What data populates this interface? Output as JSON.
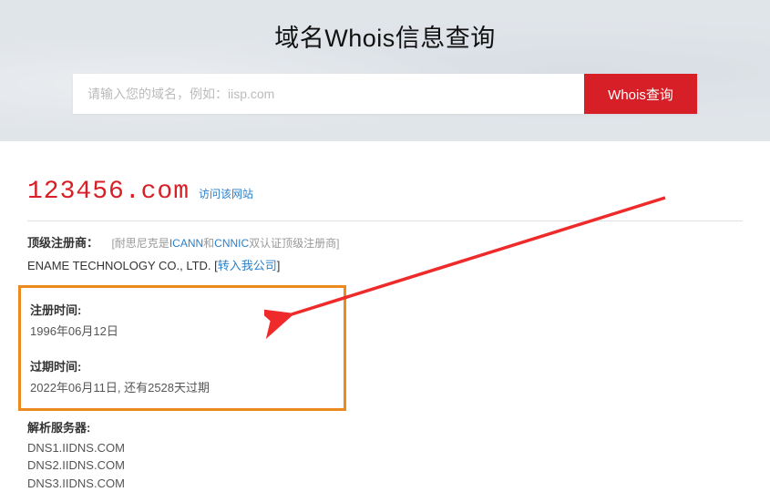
{
  "hero": {
    "title": "域名Whois信息查询",
    "placeholder": "请输入您的域名，例如：iisp.com",
    "button": "Whois查询"
  },
  "domain": {
    "name": "123456.com",
    "visit_label": "访问该网站"
  },
  "registrar": {
    "label": "顶级注册商：",
    "note_prefix": "[耐思尼克是",
    "icann": "ICANN",
    "and": "和",
    "cnnic": "CNNIC",
    "note_suffix": "双认证顶级注册商]",
    "company": "ENAME TECHNOLOGY CO., LTD. [",
    "transfer": "转入我公司",
    "company_close": "]"
  },
  "dates": {
    "reg_label": "注册时间:",
    "reg_value": "1996年06月12日",
    "exp_label": "过期时间:",
    "exp_value": "2022年06月11日, 还有2528天过期"
  },
  "dns": {
    "label": "解析服务器:",
    "items": [
      "DNS1.IIDNS.COM",
      "DNS2.IIDNS.COM",
      "DNS3.IIDNS.COM"
    ]
  }
}
